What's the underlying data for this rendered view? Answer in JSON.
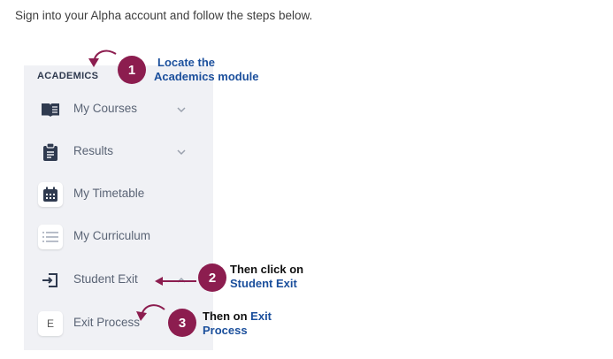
{
  "intro": "Sign into your Alpha account and follow the steps below.",
  "sidebar": {
    "section": "ACADEMICS",
    "items": [
      {
        "label": "My Courses"
      },
      {
        "label": "Results"
      },
      {
        "label": "My Timetable"
      },
      {
        "label": "My Curriculum"
      },
      {
        "label": "Student Exit"
      },
      {
        "label": "Exit Process",
        "icon_letter": "E"
      }
    ]
  },
  "steps": [
    {
      "number": "1",
      "line1": "Locate the",
      "line2": "Academics module"
    },
    {
      "number": "2",
      "line1": "Then click on",
      "line2": "Student Exit"
    },
    {
      "number": "3",
      "line1_a": "Then on ",
      "line1_b": "Exit",
      "line2": "Process"
    }
  ],
  "colors": {
    "badge": "#8c1d4f",
    "highlight_text": "#1b4f9c",
    "sidebar_bg": "#f0f1f5",
    "icon": "#2f3a4f"
  }
}
